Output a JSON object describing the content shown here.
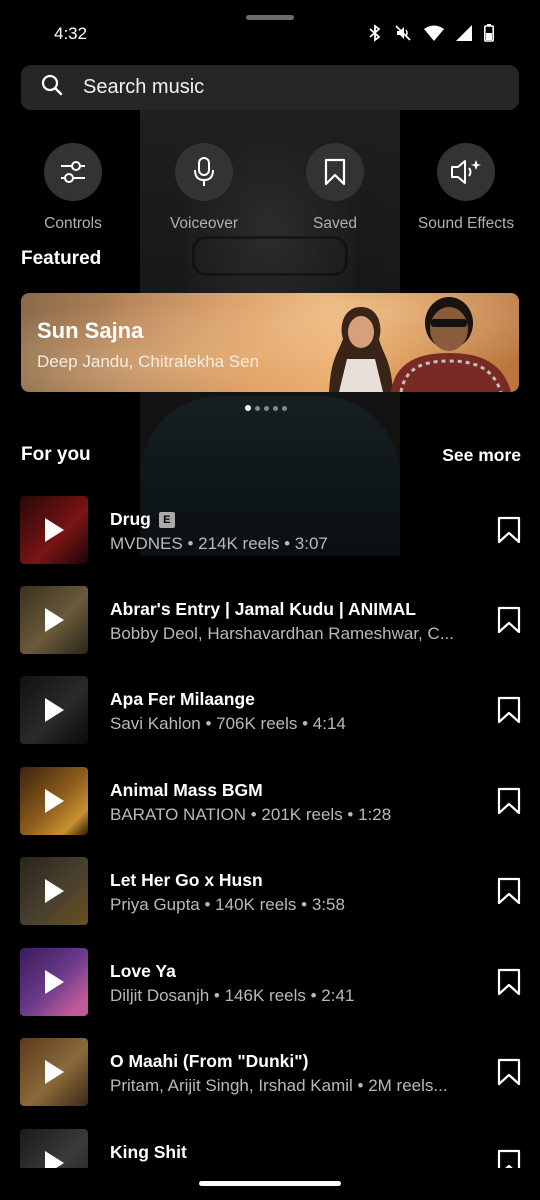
{
  "status_bar": {
    "time": "4:32",
    "icons": [
      "bluetooth-icon",
      "mute-icon",
      "wifi-icon",
      "signal-icon",
      "battery-icon"
    ]
  },
  "search": {
    "placeholder": "Search music"
  },
  "actions": [
    {
      "label": "Controls",
      "icon": "sliders-icon"
    },
    {
      "label": "Voiceover",
      "icon": "microphone-icon"
    },
    {
      "label": "Saved",
      "icon": "bookmark-icon"
    },
    {
      "label": "Sound Effects",
      "icon": "sound-effects-icon"
    }
  ],
  "featured": {
    "heading": "Featured",
    "banner": {
      "title": "Sun Sajna",
      "artists": "Deep Jandu, Chitralekha Sen"
    },
    "pages": 5,
    "active_page": 1
  },
  "for_you": {
    "heading": "For you",
    "see_more": "See more",
    "tracks": [
      {
        "title": "Drug",
        "explicit": "E",
        "meta": "MVDNES • 214K reels • 3:07",
        "thumb_color": "#7a1414"
      },
      {
        "title": "Abrar's Entry | Jamal Kudu | ANIMAL",
        "meta": "Bobby Deol, Harshavardhan Rameshwar, C...",
        "thumb_color": "#6b5a3a"
      },
      {
        "title": "Apa Fer Milaange",
        "meta": "Savi Kahlon • 706K reels • 4:14",
        "thumb_color": "#2a2a2a"
      },
      {
        "title": "Animal Mass BGM",
        "meta": "BARATO NATION • 201K reels • 1:28",
        "thumb_color": "#8a5a1a"
      },
      {
        "title": "Let Her Go x Husn",
        "meta": "Priya Gupta • 140K reels • 3:58",
        "thumb_color": "#4a4030"
      },
      {
        "title": "Love Ya",
        "meta": "Diljit Dosanjh • 146K reels • 2:41",
        "thumb_color": "#6a3a8a"
      },
      {
        "title": "O Maahi (From \"Dunki\")",
        "meta": "Pritam, Arijit Singh, Irshad Kamil • 2M reels...",
        "thumb_color": "#8a6a3a"
      },
      {
        "title": "King Shit",
        "meta": "",
        "thumb_color": "#3a3a3a"
      }
    ]
  }
}
